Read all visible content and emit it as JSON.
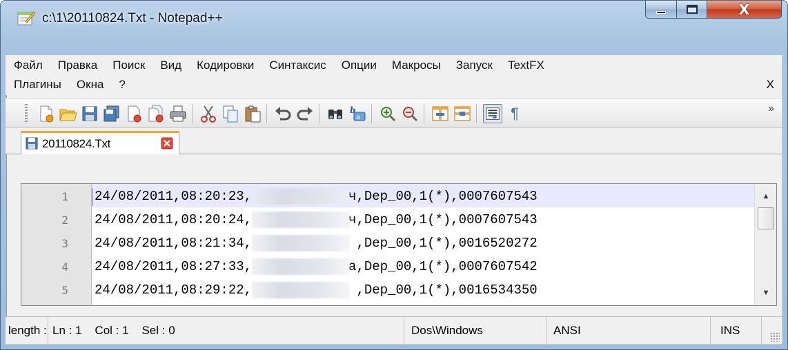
{
  "window": {
    "title": "c:\\1\\20110824.Txt - Notepad++",
    "close_glyph": "X"
  },
  "menu": {
    "row1": [
      "Файл",
      "Правка",
      "Поиск",
      "Вид",
      "Кодировки",
      "Синтаксис",
      "Опции",
      "Макросы",
      "Запуск",
      "TextFX"
    ],
    "row2": [
      "Плагины",
      "Окна",
      "?"
    ],
    "mdi_close": "X"
  },
  "toolbar": {
    "buttons": [
      "new-file",
      "open-file",
      "save",
      "save-all",
      "close",
      "close-all",
      "print",
      "cut",
      "copy",
      "paste",
      "undo",
      "redo",
      "find",
      "replace",
      "zoom-in",
      "zoom-out",
      "sync-vertical",
      "sync-horizontal",
      "word-wrap",
      "show-all-characters"
    ],
    "show_all_glyph": "¶",
    "overflow_glyph": "»"
  },
  "tab": {
    "label": "20110824.Txt"
  },
  "editor": {
    "line_numbers": [
      "1",
      "2",
      "3",
      "4",
      "5"
    ],
    "lines": [
      {
        "before": "24/08/2011,08:20:23,",
        "visible_start": "",
        "visible_end": "ч",
        "after": ",Dep_00,1(*),0007607543"
      },
      {
        "before": "24/08/2011,08:20:24,",
        "visible_start": "",
        "visible_end": "ч",
        "after": ",Dep_00,1(*),0007607543"
      },
      {
        "before": "24/08/2011,08:21:34,",
        "visible_start": "",
        "visible_end": " ",
        "after": ",Dep_00,1(*),0016520272"
      },
      {
        "before": "24/08/2011,08:27:33,",
        "visible_start": "",
        "visible_end": "а",
        "after": ",Dep_00,1(*),0007607542"
      },
      {
        "before": "24/08/2011,08:29:22,",
        "visible_start": "",
        "visible_end": " ",
        "after": ",Dep_00,1(*),0016534350"
      }
    ]
  },
  "statusbar": {
    "length": "length :",
    "position": "Ln : 1    Col : 1    Sel : 0",
    "eol": "Dos\\Windows",
    "encoding": "ANSI",
    "mode": "INS"
  }
}
